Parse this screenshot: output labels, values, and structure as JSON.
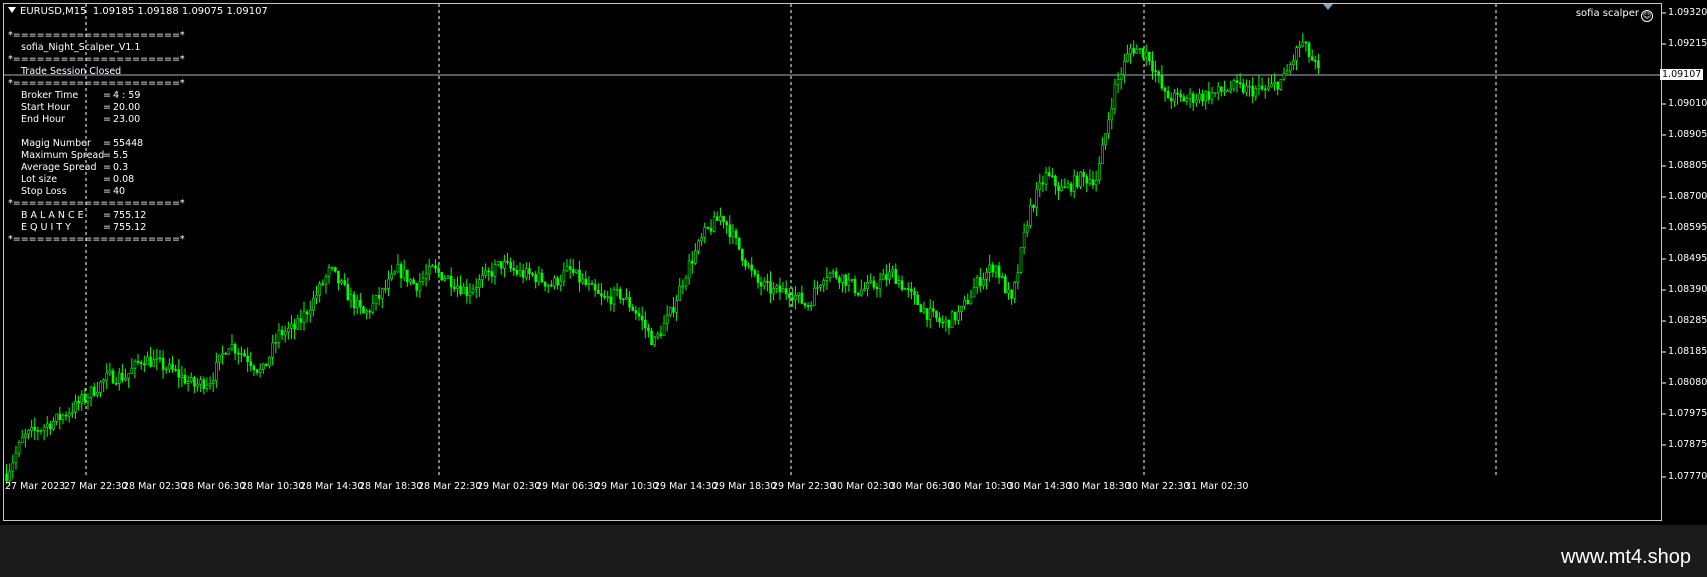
{
  "header": {
    "symbol_timeframe": "EURUSD,M15",
    "ohlc": "1.09185 1.09188 1.09075 1.09107"
  },
  "indicator_label": "sofia scalper",
  "info_panel": {
    "separator": "*=====================*",
    "title": "sofia_Night_Scalper_V1.1",
    "status": "Trade Session Closed",
    "rows_time": [
      {
        "label": "Broker Time",
        "value": "4 : 59"
      },
      {
        "label": "Start Hour",
        "value": "20.00"
      },
      {
        "label": "End Hour",
        "value": "23.00"
      }
    ],
    "rows_params": [
      {
        "label": "Magig Number",
        "value": "55448"
      },
      {
        "label": "Maximum Spread",
        "value": "5.5"
      },
      {
        "label": "Average Spread",
        "value": "0.3"
      },
      {
        "label": "Lot size",
        "value": "0.08"
      },
      {
        "label": "Stop Loss",
        "value": "40"
      }
    ],
    "rows_account": [
      {
        "label": "B A L A N C E",
        "value": "755.12"
      },
      {
        "label": "E Q U I T Y",
        "value": "755.12"
      }
    ]
  },
  "price_axis": {
    "ticks": [
      "1.09320",
      "1.09215",
      "1.09107",
      "1.09010",
      "1.08905",
      "1.08805",
      "1.08700",
      "1.08595",
      "1.08495",
      "1.08390",
      "1.08285",
      "1.08185",
      "1.08080",
      "1.07975",
      "1.07875",
      "1.07770"
    ],
    "current_price": "1.09107"
  },
  "time_axis": {
    "labels": [
      "27 Mar 2023",
      "27 Mar 22:30",
      "28 Mar 02:30",
      "28 Mar 06:30",
      "28 Mar 10:30",
      "28 Mar 14:30",
      "28 Mar 18:30",
      "28 Mar 22:30",
      "29 Mar 02:30",
      "29 Mar 06:30",
      "29 Mar 10:30",
      "29 Mar 14:30",
      "29 Mar 18:30",
      "29 Mar 22:30",
      "30 Mar 02:30",
      "30 Mar 06:30",
      "30 Mar 10:30",
      "30 Mar 14:30",
      "30 Mar 18:30",
      "30 Mar 22:30",
      "31 Mar 02:30"
    ]
  },
  "colors": {
    "background": "#000000",
    "candle": "#00ff00",
    "grid": "#ffffff",
    "bid_line": "#aab3c0"
  },
  "watermark": "www.mt4.shop",
  "chart_data": {
    "type": "line",
    "series": [
      {
        "values": [
          1.0779,
          1.0791,
          1.0794,
          1.0797,
          1.0801,
          1.0806,
          1.0811,
          1.0811,
          1.0817,
          1.0815,
          1.0812,
          1.0808,
          1.081,
          1.0822,
          1.0818,
          1.0812,
          1.0825,
          1.0827,
          1.0836,
          1.0846,
          1.0838,
          1.0831,
          1.0838,
          1.0846,
          1.0841,
          1.0846,
          1.0843,
          1.0839,
          1.0843,
          1.0848,
          1.0845,
          1.0844,
          1.0841,
          1.0846,
          1.0841,
          1.0836,
          1.0838,
          1.0832,
          1.0822,
          1.0832,
          1.0847,
          1.0858,
          1.0864,
          1.0853,
          1.0842,
          1.0839,
          1.0839,
          1.0834,
          1.0845,
          1.0844,
          1.0839,
          1.0841,
          1.0845,
          1.0838,
          1.0832,
          1.0828,
          1.0832,
          1.0842,
          1.0848,
          1.0835,
          1.0865,
          1.0877,
          1.0872,
          1.0876,
          1.0876,
          1.0905,
          1.0919,
          1.0917,
          1.0903,
          1.0902,
          1.0903,
          1.0904,
          1.0906,
          1.0905,
          1.0905,
          1.0909,
          1.0921,
          1.0911
        ]
      }
    ],
    "ylim": [
      1.0777,
      1.0932
    ],
    "grid": true
  }
}
